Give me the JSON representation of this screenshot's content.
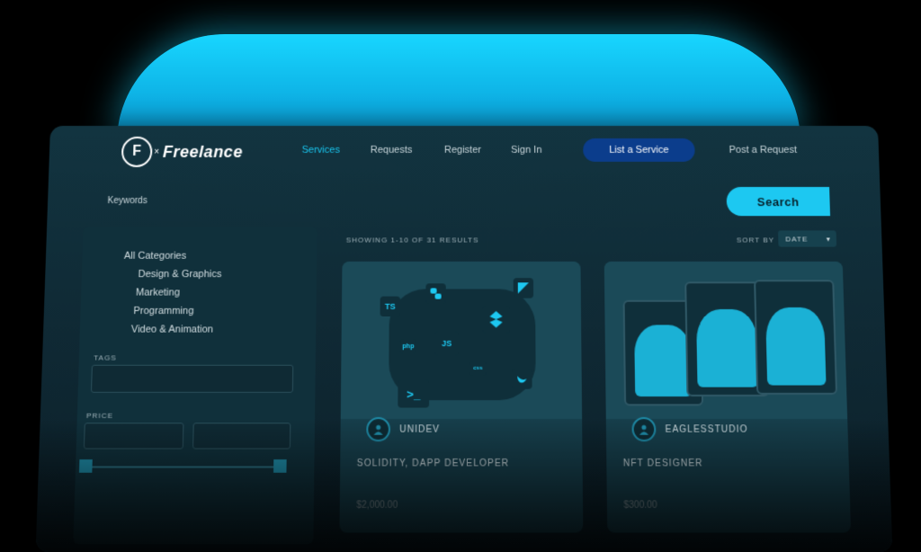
{
  "brand": {
    "name": "Freelance",
    "mark": "F"
  },
  "nav": {
    "services": "Services",
    "requests": "Requests",
    "register": "Register",
    "sign_in": "Sign In",
    "list_service": "List a Service",
    "post_request": "Post a Request"
  },
  "search": {
    "placeholder": "Keywords",
    "button": "Search"
  },
  "sidebar": {
    "categories": [
      "All Categories",
      "Design & Graphics",
      "Marketing",
      "Programming",
      "Video & Animation"
    ],
    "tags_label": "TAGS",
    "price_label": "PRICE"
  },
  "results": {
    "summary": "SHOWING 1-10 OF 31 RESULTS",
    "sort_label": "SORT BY",
    "sort_value": "DATE"
  },
  "cards": [
    {
      "seller": "UNIDEV",
      "title": "SOLIDITY, DAPP DEVELOPER",
      "price": "$2,000.00",
      "badges": [
        "TS",
        "JS",
        ">_",
        "php",
        "css"
      ]
    },
    {
      "seller": "EAGLESSTUDIO",
      "title": "NFT DESIGNER",
      "price": "$300.00"
    }
  ],
  "colors": {
    "accent": "#1dc8f1",
    "nav_button": "#0b3d8c",
    "panel": "#123440"
  }
}
